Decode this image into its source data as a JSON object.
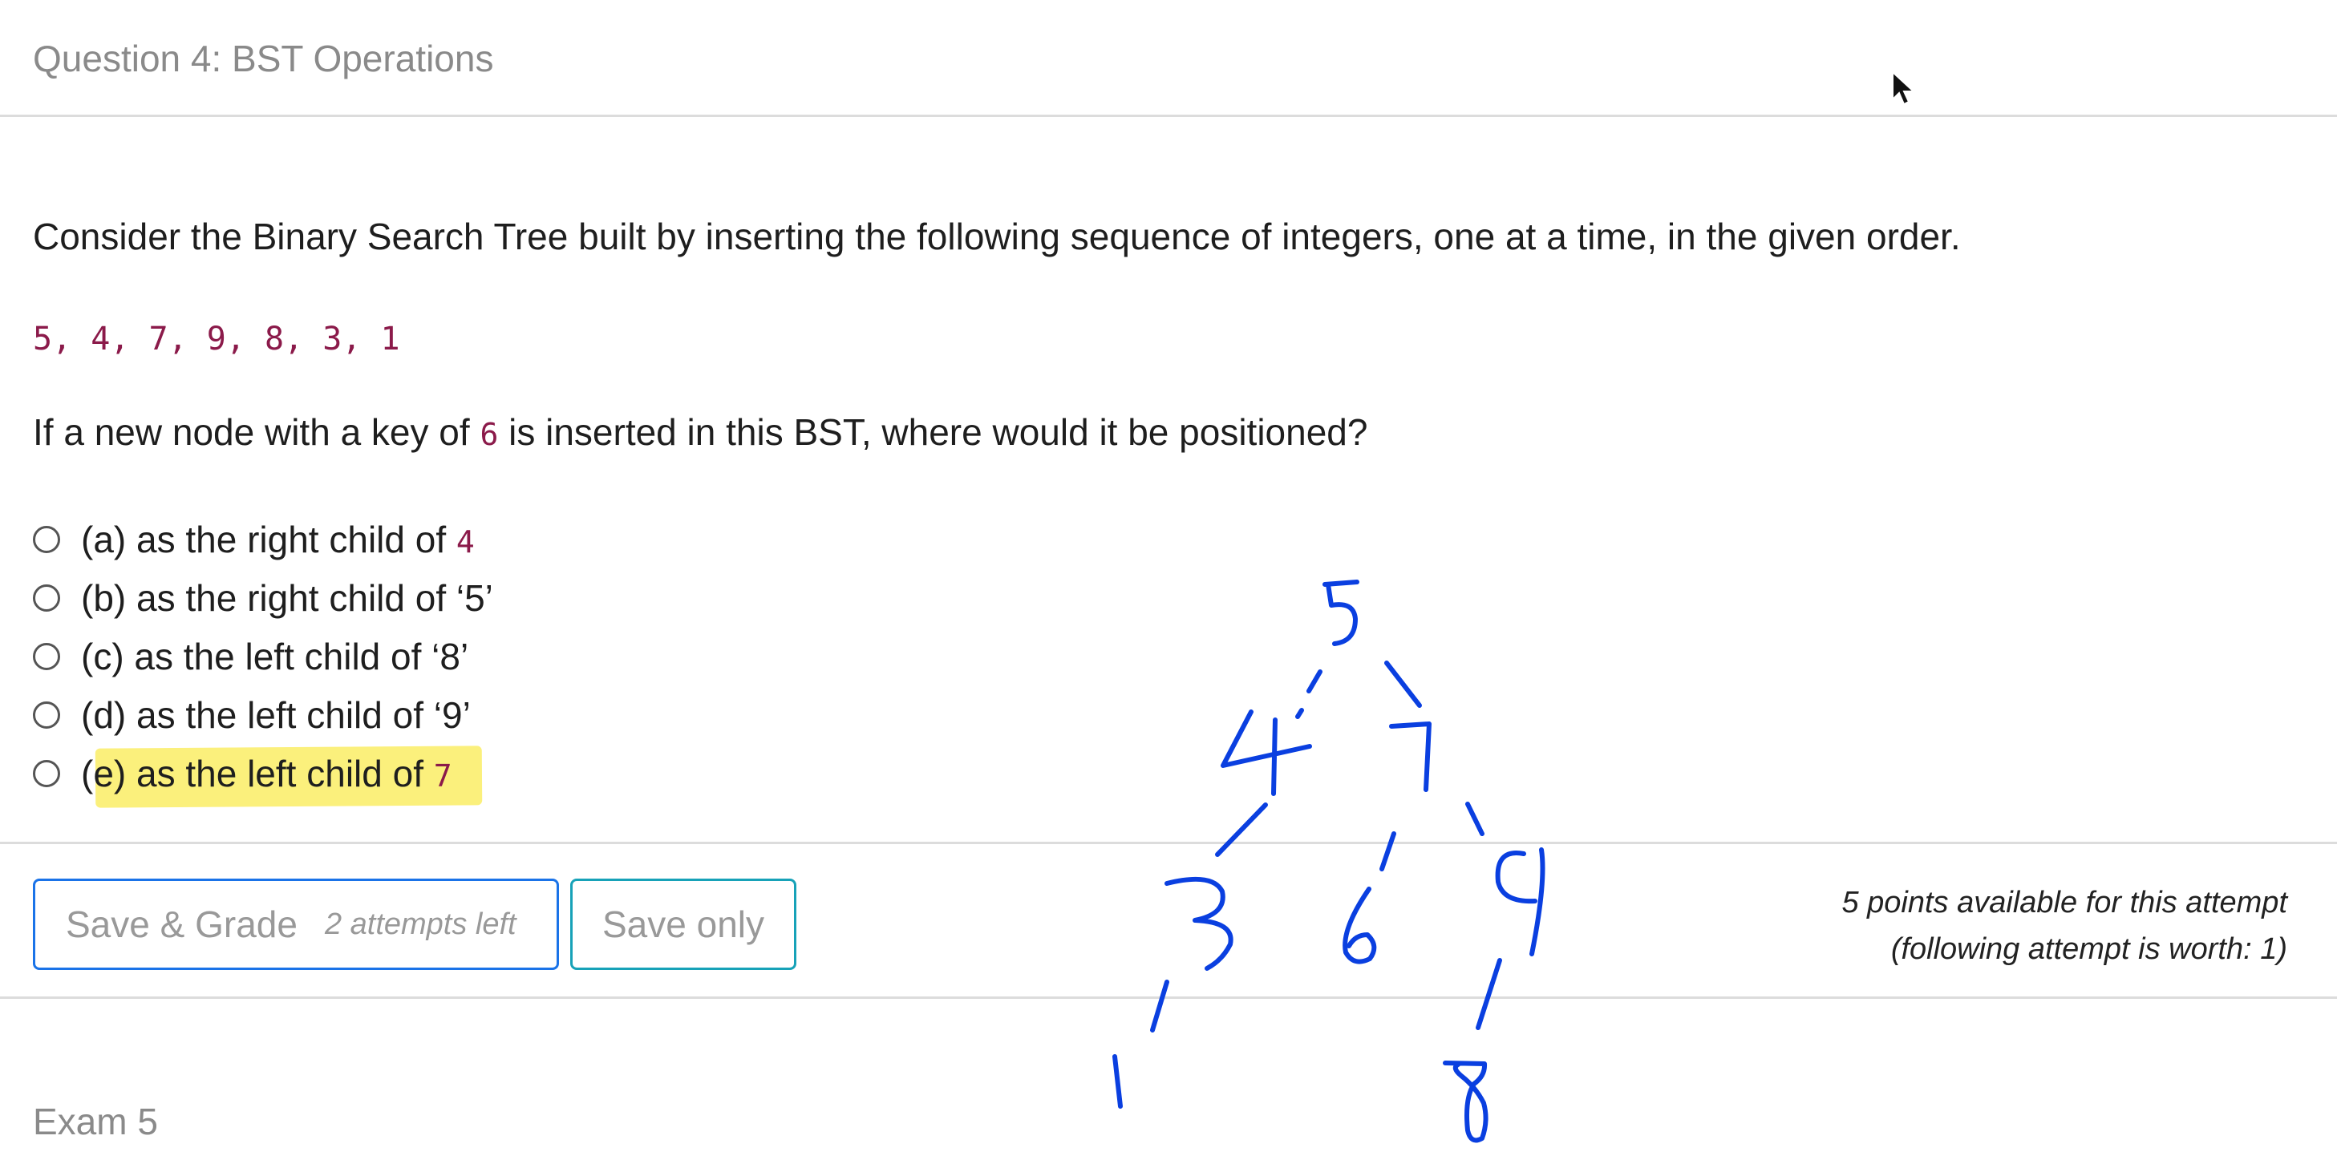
{
  "header": {
    "title": "Question 4: BST Operations"
  },
  "question": {
    "prompt": "Consider the Binary Search Tree built by inserting the following sequence of integers, one at a time, in the given order.",
    "sequence": "5, 4, 7, 9, 8, 3, 1",
    "ask_before": "If a new node with a key of ",
    "ask_key": "6",
    "ask_after": " is inserted in this BST, where would it be positioned?",
    "options": [
      {
        "text": "(a) as the right child of ",
        "code": "4"
      },
      {
        "text": "(b) as the right child of ‘5’",
        "code": ""
      },
      {
        "text": "(c) as the left child of ‘8’",
        "code": ""
      },
      {
        "text": "(d) as the left child of ‘9’",
        "code": ""
      },
      {
        "text": "(e) as the left child of ",
        "code": "7"
      }
    ],
    "highlighted_option": 4,
    "highlight_color": "#fbf07c"
  },
  "footer": {
    "grade_button_label": "Save & Grade",
    "attempts_left": "2 attempts left",
    "save_only_label": "Save only",
    "points_line1": "5 points available for this attempt",
    "points_line2": "(following attempt is worth: 1)"
  },
  "exam": {
    "label": "Exam 5"
  },
  "annotation": {
    "color": "#0a3fe0",
    "tree_nodes": [
      "5",
      "4",
      "7",
      "3",
      "6",
      "9",
      "1",
      "8"
    ]
  },
  "icons": {
    "cursor": "mouse-pointer-icon"
  }
}
